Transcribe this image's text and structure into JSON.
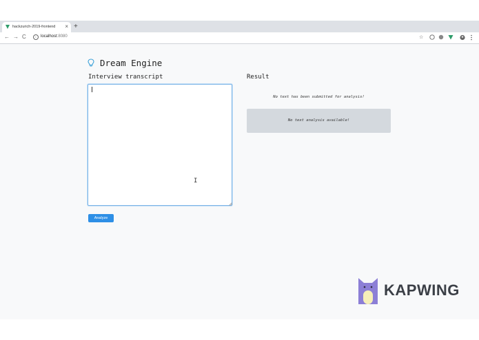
{
  "browser": {
    "tab_title": "hackzurich-2019-frontend",
    "tab_close": "×",
    "new_tab": "+",
    "back": "←",
    "forward": "→",
    "reload": "C",
    "url_host": "localhost",
    "url_port": ":8080",
    "star": "☆"
  },
  "app": {
    "title": "Dream Engine",
    "input_label": "Interview transcript",
    "result_label": "Result",
    "analyze_button": "Analyze",
    "no_submission": "No text has been submitted for analysis!",
    "no_analysis": "No text analysis available!",
    "transcript_value": ""
  },
  "watermark": {
    "text": "KAPWING"
  },
  "colors": {
    "accent": "#2e8fe6",
    "page_bg": "#f8f9fa",
    "analysis_bg": "#d4d9de",
    "focus_border": "#7ab3e6"
  }
}
